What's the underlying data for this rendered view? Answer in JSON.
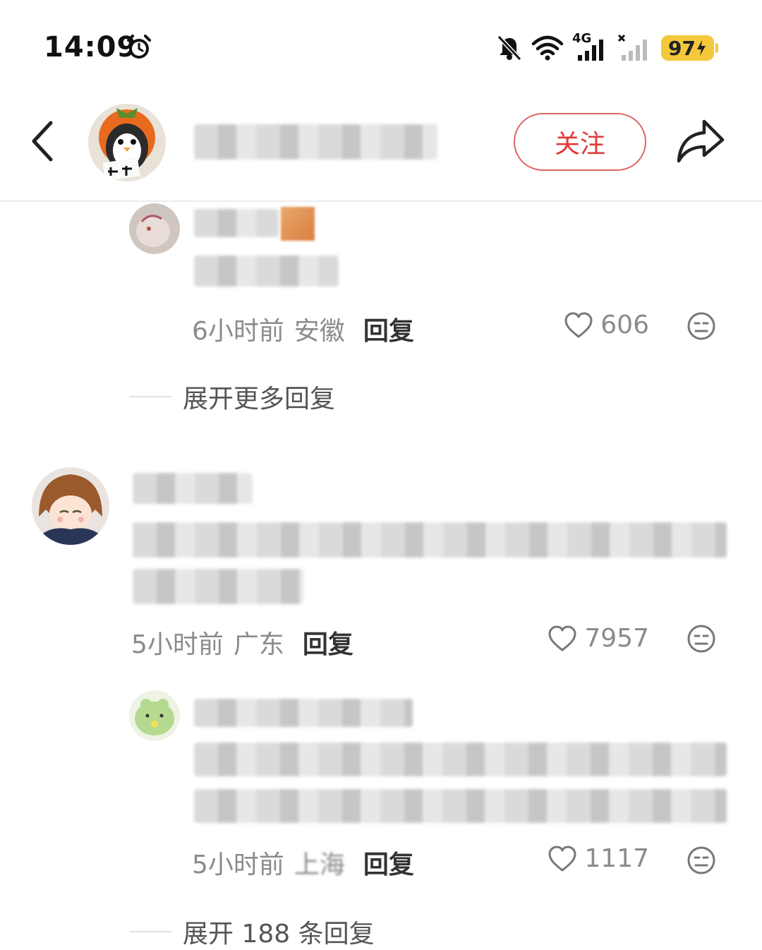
{
  "status_bar": {
    "time": "14:09",
    "network": "4G",
    "battery": "97"
  },
  "header": {
    "follow_label": "关注"
  },
  "comments": [
    {
      "time": "6小时前",
      "location": "安徽",
      "reply_label": "回复",
      "likes": "606",
      "expand_label": "展开更多回复"
    },
    {
      "time": "5小时前",
      "location": "广东",
      "reply_label": "回复",
      "likes": "7957"
    },
    {
      "time": "5小时前",
      "location": "上海",
      "reply_label": "回复",
      "likes": "1117",
      "expand_label": "展开 188 条回复"
    }
  ],
  "icons": {
    "back": "back-arrow-icon",
    "share": "share-icon",
    "like": "heart-icon",
    "dislike": "meh-face-icon",
    "alarm": "alarm-icon",
    "mute": "bell-off-icon",
    "wifi": "wifi-icon",
    "signal": "signal-icon"
  },
  "colors": {
    "follow_accent": "#e03a3a",
    "battery": "#f3c93b"
  }
}
